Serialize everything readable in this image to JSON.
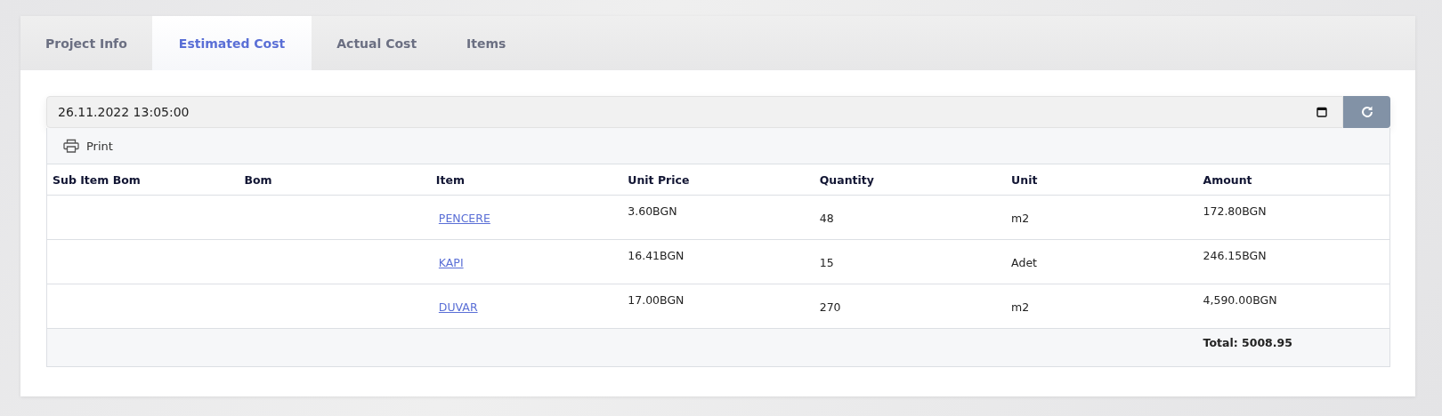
{
  "tabs": [
    {
      "label": "Project Info",
      "selected": false
    },
    {
      "label": "Estimated Cost",
      "selected": true
    },
    {
      "label": "Actual Cost",
      "selected": false
    },
    {
      "label": "Items",
      "selected": false
    }
  ],
  "date_field": {
    "value": "26.11.2022 13:05:00"
  },
  "toolbar": {
    "print_label": "Print"
  },
  "table": {
    "columns": [
      "Sub Item Bom",
      "Bom",
      "Item",
      "Unit Price",
      "Quantity",
      "Unit",
      "Amount"
    ],
    "rows": [
      {
        "sub_item_bom": "",
        "bom": "",
        "item": "PENCERE",
        "unit_price": "3.60BGN",
        "quantity": "48",
        "unit": "m2",
        "amount": "172.80BGN"
      },
      {
        "sub_item_bom": "",
        "bom": "",
        "item": "KAPI",
        "unit_price": "16.41BGN",
        "quantity": "15",
        "unit": "Adet",
        "amount": "246.15BGN"
      },
      {
        "sub_item_bom": "",
        "bom": "",
        "item": "DUVAR",
        "unit_price": "17.00BGN",
        "quantity": "270",
        "unit": "m2",
        "amount": "4,590.00BGN"
      }
    ],
    "total": "Total: 5008.95"
  }
}
